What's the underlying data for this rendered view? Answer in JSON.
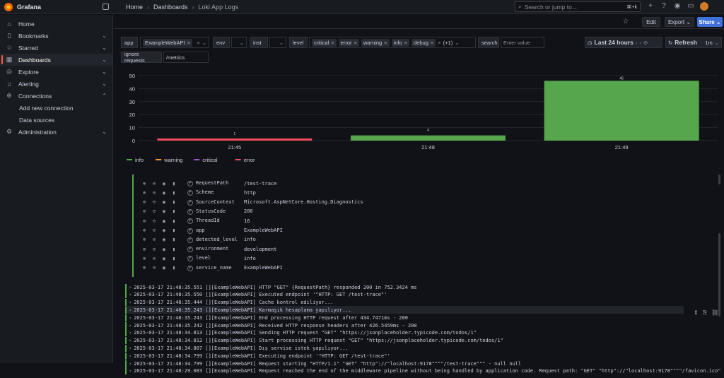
{
  "app": {
    "name": "Grafana"
  },
  "breadcrumb": {
    "home": "Home",
    "dashboards": "Dashboards",
    "current": "Loki App Logs"
  },
  "search": {
    "placeholder": "Search or jump to...",
    "shortcut": "⌘+k"
  },
  "sidebar": {
    "items": [
      {
        "label": "Home",
        "icon": "home-icon"
      },
      {
        "label": "Bookmarks",
        "icon": "bookmark-icon"
      },
      {
        "label": "Starred",
        "icon": "star-icon"
      },
      {
        "label": "Dashboards",
        "icon": "dashboards-icon"
      },
      {
        "label": "Explore",
        "icon": "compass-icon"
      },
      {
        "label": "Alerting",
        "icon": "bell-icon"
      },
      {
        "label": "Connections",
        "icon": "plug-icon"
      },
      {
        "label": "Add new connection"
      },
      {
        "label": "Data sources"
      },
      {
        "label": "Administration",
        "icon": "gear-icon"
      }
    ]
  },
  "toolbar": {
    "edit": "Edit",
    "export": "Export",
    "share": "Share"
  },
  "variables": {
    "app_label": "app",
    "app_value": "ExampleWebAPI",
    "env_label": "env",
    "inst_label": "inst",
    "level_label": "level",
    "level_chips": [
      "critical",
      "error",
      "warning",
      "info",
      "debug"
    ],
    "level_more": "(+1)",
    "search_label": "search",
    "search_placeholder": "Enter value",
    "ignore_label": "ignore requests",
    "ignore_value": "/metrics"
  },
  "time": {
    "range": "Last 24 hours",
    "refresh": "Refresh",
    "interval": "1m"
  },
  "chart_data": {
    "type": "bar",
    "categories": [
      "21:45",
      "21:48",
      "21:49"
    ],
    "series": [
      {
        "name": "info",
        "color": "#56a64b",
        "values": [
          0,
          4,
          46
        ]
      },
      {
        "name": "warning",
        "color": "#ff9830",
        "values": [
          0,
          0,
          0
        ]
      },
      {
        "name": "critical",
        "color": "#a352cc",
        "values": [
          0,
          0,
          0
        ]
      },
      {
        "name": "error",
        "color": "#f2495c",
        "values": [
          1,
          0,
          0
        ]
      }
    ],
    "data_labels": [
      "1",
      "4",
      "46"
    ],
    "yticks": [
      "0",
      "10",
      "20",
      "30",
      "40",
      "50"
    ],
    "ylim": [
      0,
      50
    ],
    "legend": "bottom-left"
  },
  "log_details": [
    {
      "key": "RequestPath",
      "value": "/test-trace"
    },
    {
      "key": "Scheme",
      "value": "http"
    },
    {
      "key": "SourceContext",
      "value": "Microsoft.AspNetCore.Hosting.Diagnostics"
    },
    {
      "key": "StatusCode",
      "value": "200"
    },
    {
      "key": "ThreadId",
      "value": "16"
    },
    {
      "key": "app",
      "value": "ExampleWebAPI"
    },
    {
      "key": "detected_level",
      "value": "info"
    },
    {
      "key": "environment",
      "value": "development"
    },
    {
      "key": "level",
      "value": "info"
    },
    {
      "key": "service_name",
      "value": "ExampleWebAPI"
    }
  ],
  "log_lines": [
    "2025-03-17 21:48:35.551 [][ExampleWebAPI] HTTP \"GET\" {RequestPath} responded 200 in 752.3424 ms",
    "2025-03-17 21:48:35.550 [][ExampleWebAPI] Executed endpoint '\"HTTP: GET /test-trace\"'",
    "2025-03-17 21:48:35.444 [][ExampleWebAPI] Cache kontrol ediliyor...",
    "2025-03-17 21:48:35.243 [][ExampleWebAPI] Karmaşık hesaplama yapılıyor...",
    "2025-03-17 21:48:35.243 [][ExampleWebAPI] End processing HTTP request after 434.7471ms - 200",
    "2025-03-17 21:48:35.242 [][ExampleWebAPI] Received HTTP response headers after 426.5459ms - 200",
    "2025-03-17 21:48:34.813 [][ExampleWebAPI] Sending HTTP request \"GET\" \"https://jsonplaceholder.typicode.com/todos/1\"",
    "2025-03-17 21:48:34.812 [][ExampleWebAPI] Start processing HTTP request \"GET\" \"https://jsonplaceholder.typicode.com/todos/1\"",
    "2025-03-17 21:48:34.807 [][ExampleWebAPI] Dış servise istek yapılıyor...",
    "2025-03-17 21:48:34.799 [][ExampleWebAPI] Executing endpoint '\"HTTP: GET /test-trace\"'",
    "2025-03-17 21:48:34.799 [][ExampleWebAPI] Request starting \"HTTP/1.1\" \"GET\" \"http\"://\"localhost:9178\"\"\"\"/test-trace\"\"\" - null null",
    "2025-03-17 21:48:29.083 [][ExampleWebAPI] Request reached the end of the middleware pipeline without being handled by application code. Request path: \"GET\" \"http\"://\"localhost:9178\"\"\"\"/favicon.ico\", Response"
  ]
}
